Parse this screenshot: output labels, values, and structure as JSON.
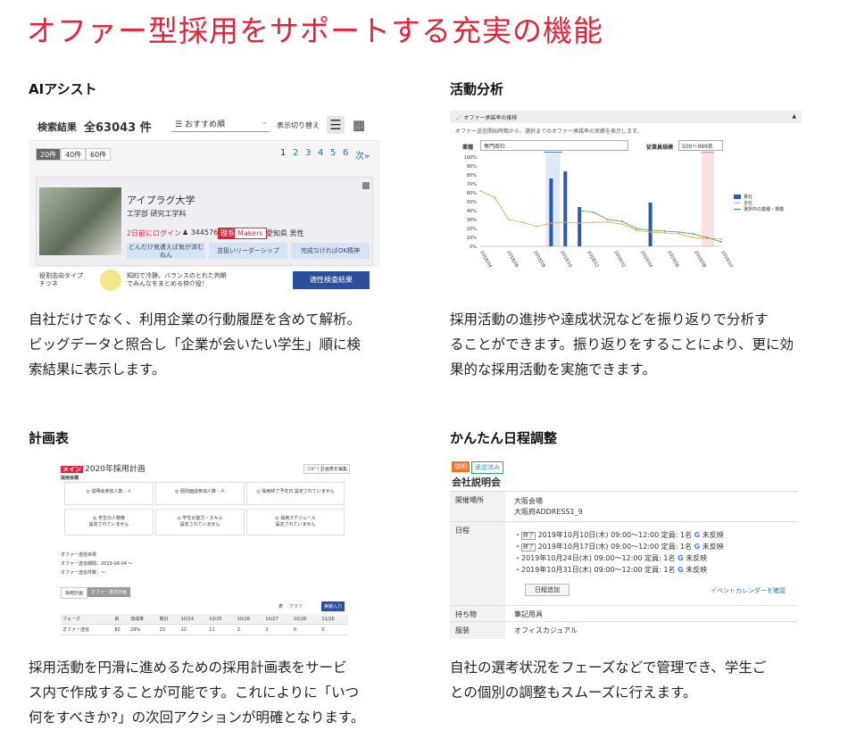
{
  "page": {
    "title": "オファー型採用をサポートする充実の機能"
  },
  "features": {
    "ai": {
      "title": "AIアシスト",
      "desc": [
        "自社だけでなく、利用企業の行動履歴を含めて解析。",
        "ビッグデータと照合し「企業が会いたい学生」順に検",
        "索結果に表示します。"
      ]
    },
    "analysis": {
      "title": "活動分析",
      "desc": [
        "採用活動の進捗や達成状況などを振り返りで分析す",
        "ることができます。振り返りをすることにより、更に効",
        "果的な採用活動を実施できます。"
      ]
    },
    "plan": {
      "title": "計画表",
      "desc": [
        "採用活動を円滑に進めるための採用計画表をサービ",
        "ス内で作成することが可能です。これによりに「いつ",
        "何をすべきか?」の次回アクションが明確となります。"
      ]
    },
    "schedule": {
      "title": "かんたん日程調整",
      "desc": [
        "自社の選考状況をフェーズなどで管理でき、学生ご",
        "との個別の調整もスムーズに行えます。"
      ]
    }
  },
  "ai_shot": {
    "label": "検索結果",
    "count": "全63043 件",
    "sort": "おすすめ順",
    "view_toggle": "表示切り替え",
    "per_page": [
      "20件",
      "40件",
      "60件"
    ],
    "pages": [
      "1",
      "2",
      "3",
      "4",
      "5",
      "6",
      "次»"
    ],
    "university": "アイプラグ大学",
    "department": "工学部 研究工学科",
    "login": "2日前にログイン",
    "student_id": "344576",
    "tag1": "理系",
    "tag2": "Makers",
    "location": "愛知県 男性",
    "keywords": [
      "どんだけ気遣えば気が済む\nねん",
      "並扱いリーダーシップ",
      "完成なければOK精神"
    ],
    "personality_label": "役割志向タイプ\nチツネ",
    "personality_text": "知的で冷静。バランスのとれた判断\nでみんなをまとめる仲介役！",
    "button": "適性検査結果"
  },
  "analysis_shot": {
    "header": "オファー承諾率の推移",
    "note": "オファー送信開始時期から、選択までのオファー承諾率の実績を表示します。",
    "filter1_label": "業種",
    "filter1": "専門商社",
    "filter2_label": "従業員規模",
    "filter2": "500〜999名"
  },
  "chart_data": {
    "type": "bar",
    "title": "",
    "categories": [
      "2018/04",
      "2018/06",
      "2018/08",
      "2018/10",
      "2018/12",
      "2019/02",
      "2019/04",
      "2019/06",
      "2019/08",
      "2019/10"
    ],
    "y_ticks": [
      "100%",
      "90%",
      "80%",
      "70%",
      "60%",
      "50%",
      "40%",
      "30%",
      "20%",
      "10%",
      "0%"
    ],
    "ylim": [
      0,
      100
    ],
    "markers": [
      "選択開始",
      "内定"
    ],
    "series": [
      {
        "name": "貴社",
        "kind": "bar",
        "values": [
          0,
          0,
          0,
          0,
          0,
          76,
          84,
          44,
          0,
          0,
          0,
          0,
          49,
          0,
          0,
          0,
          0,
          0
        ]
      },
      {
        "name": "全社",
        "kind": "line",
        "values": [
          62,
          55,
          30,
          27,
          22,
          26,
          27,
          26,
          27,
          27,
          25,
          18,
          16,
          15,
          14,
          10,
          9,
          8
        ]
      },
      {
        "name": "選択中の業種・規模",
        "kind": "line",
        "values": [
          null,
          null,
          null,
          null,
          null,
          null,
          null,
          40,
          38,
          30,
          28,
          20,
          18,
          17,
          16,
          14,
          10,
          5
        ]
      }
    ],
    "legend": "right"
  },
  "plan_shot": {
    "badge": "メイン",
    "title": "2020年採用計画",
    "section": "採用目標",
    "actions": [
      "コピー",
      "計画表を編集"
    ],
    "goals": [
      "◎ 説明会参加人数 - 人",
      "◎ 個別面談参加人数 - 人",
      "◎ 採用終了予定日 設定されていません"
    ],
    "profiles": [
      "◎ 学生の人物像",
      "◎ 学生の能力・スキル",
      "◎ 採用スケジュール"
    ],
    "unset": "設定されていません",
    "offer_section": "オファー送信目標",
    "offer_lines": [
      "オファー送信期間：2019-06-04 〜",
      "オファー送信件数：〜"
    ],
    "tabs": [
      "採用計画",
      "オファー送信計画"
    ],
    "controls": [
      "表",
      "グラフ",
      "実績入力"
    ],
    "table_head": [
      "フェーズ",
      "目",
      "達成率",
      "累計",
      "10/24",
      "10/25",
      "10/26",
      "10/27",
      "10/28",
      "11/26"
    ],
    "table_row": [
      "オファー送信",
      "80",
      "29%",
      "23",
      "12",
      "11",
      "2",
      "2",
      "0",
      "0"
    ]
  },
  "schedule_shot": {
    "badges": [
      "説明",
      "承認済み"
    ],
    "heading": "会社説明会",
    "venue_label": "開催場所",
    "venue": [
      "大阪会場",
      "大阪府ADDRESS1_9"
    ],
    "dates_label": "日程",
    "dates": [
      {
        "ended": "終了",
        "text": "2019年10月10日(木) 09:00〜12:00 定員: 1名",
        "status": "未反映"
      },
      {
        "ended": "終了",
        "text": "2019年10月17日(木) 09:00〜12:00 定員: 1名",
        "status": "未反映"
      },
      {
        "ended": "",
        "text": "2019年10月24日(木) 09:00〜12:00 定員: 1名",
        "status": "未反映"
      },
      {
        "ended": "",
        "text": "2019年10月31日(木) 09:00〜12:00 定員: 1名",
        "status": "未反映"
      }
    ],
    "add_button": "日程追加",
    "calendar_link": "イベントカレンダーを確認",
    "items_label": "持ち物",
    "items": "筆記用具",
    "dress_label": "服装",
    "dress": "オフィスカジュアル"
  }
}
